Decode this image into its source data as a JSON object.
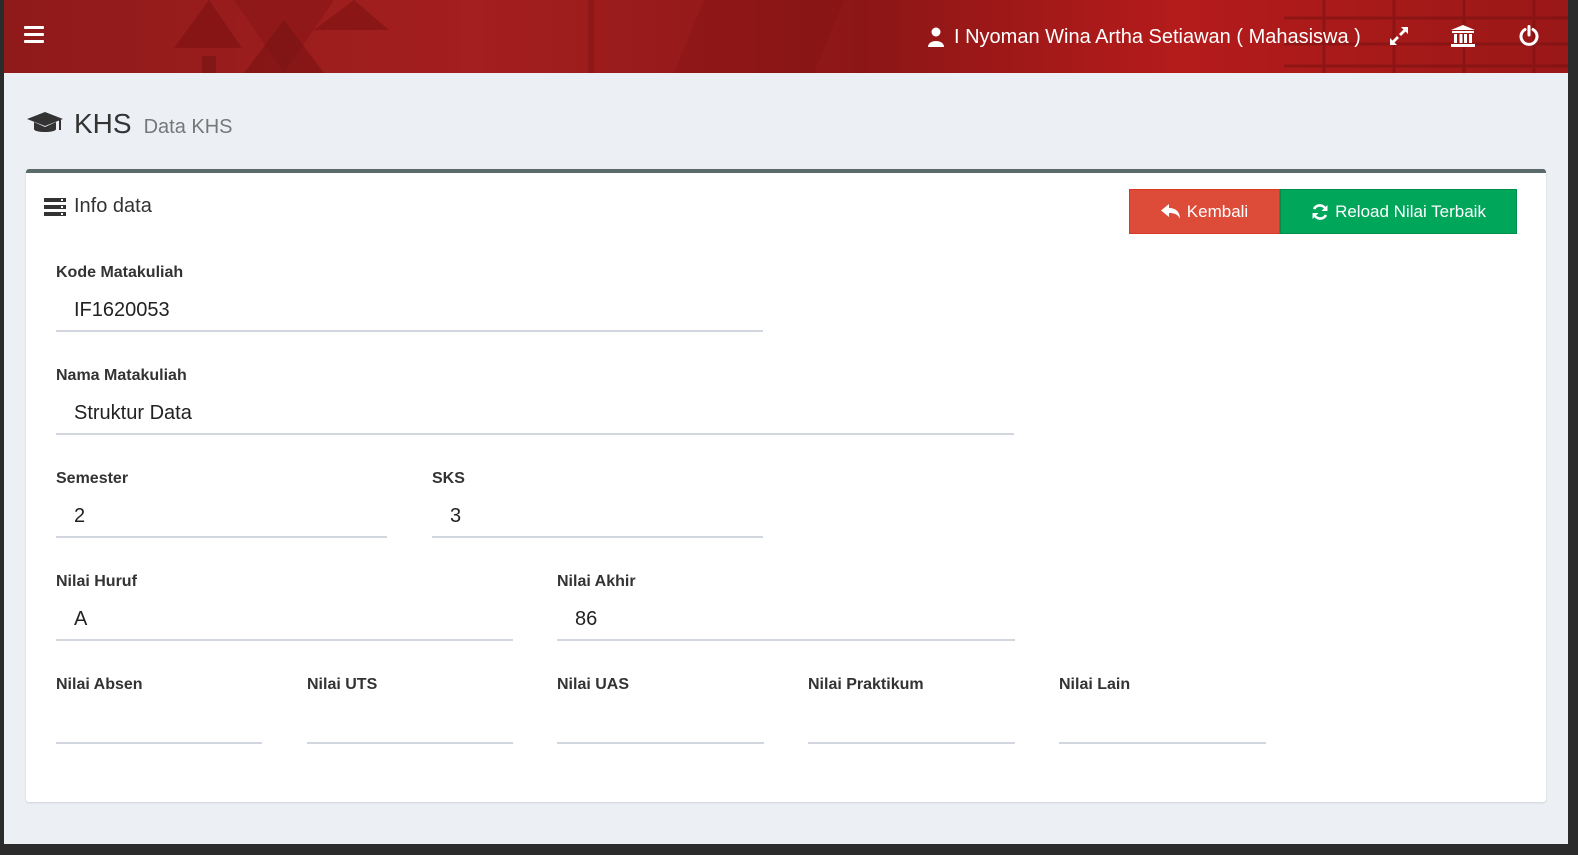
{
  "header": {
    "user_name": "I Nyoman Wina Artha Setiawan ( Mahasiswa )",
    "icons": [
      "menu-icon",
      "user-icon",
      "expand-icon",
      "institution-icon",
      "power-icon"
    ]
  },
  "page": {
    "title": "KHS",
    "subtitle": "Data KHS"
  },
  "box": {
    "title": "Info data",
    "buttons": {
      "back_label": "Kembali",
      "reload_label": "Reload Nilai Terbaik"
    }
  },
  "form": {
    "kode": {
      "label": "Kode Matakuliah",
      "value": "IF1620053"
    },
    "nama": {
      "label": "Nama Matakuliah",
      "value": "Struktur Data"
    },
    "semester": {
      "label": "Semester",
      "value": "2"
    },
    "sks": {
      "label": "SKS",
      "value": "3"
    },
    "nilai_huruf": {
      "label": "Nilai Huruf",
      "value": "A"
    },
    "nilai_akhir": {
      "label": "Nilai Akhir",
      "value": "86"
    },
    "nilai_absen": {
      "label": "Nilai Absen",
      "value": ""
    },
    "nilai_uts": {
      "label": "Nilai UTS",
      "value": ""
    },
    "nilai_uas": {
      "label": "Nilai UAS",
      "value": ""
    },
    "nilai_praktikum": {
      "label": "Nilai Praktikum",
      "value": ""
    },
    "nilai_lain": {
      "label": "Nilai Lain",
      "value": ""
    }
  },
  "colors": {
    "header_red": "#a41f1f",
    "danger": "#dd4b39",
    "success": "#00a65a",
    "box_border": "#5b6a6a"
  }
}
